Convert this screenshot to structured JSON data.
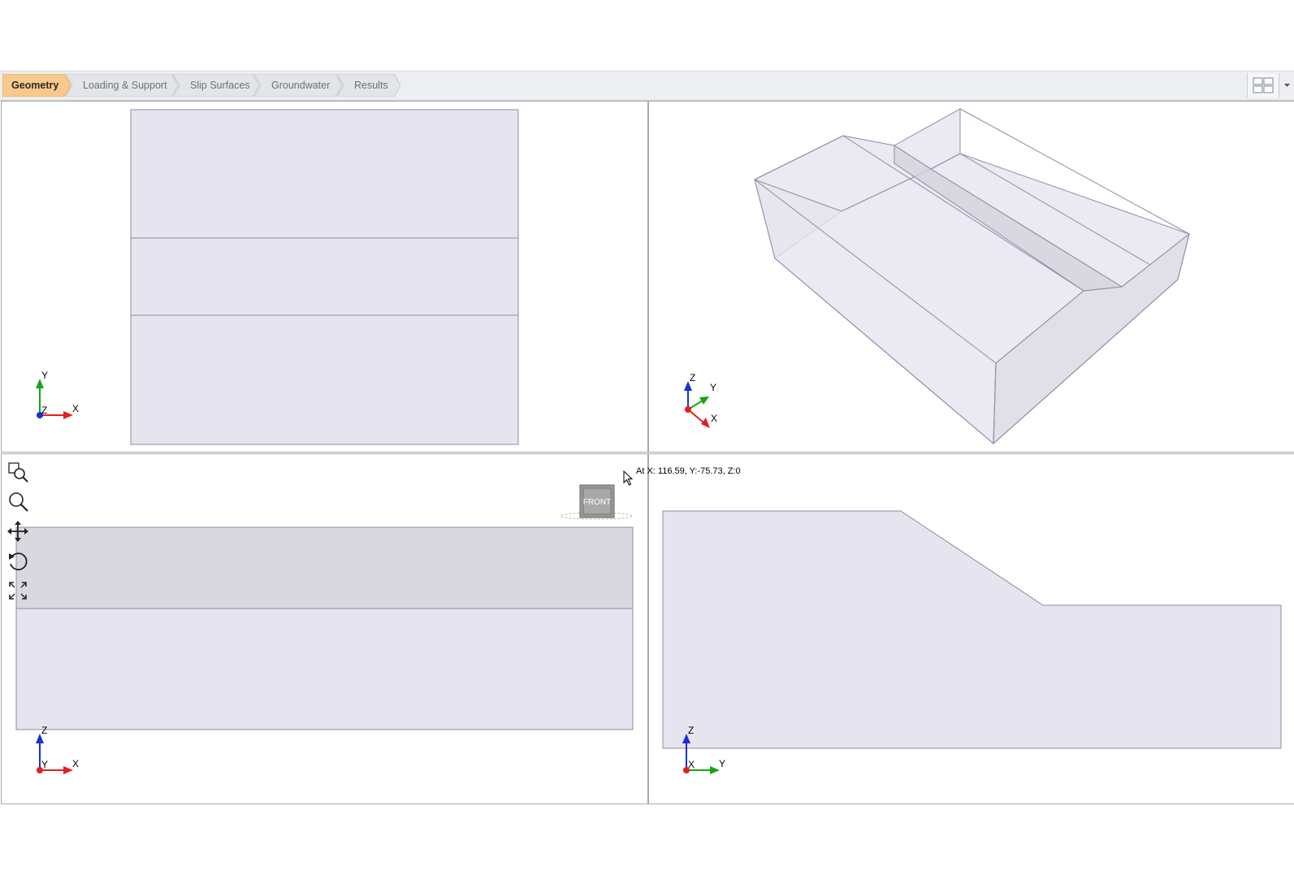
{
  "workflow": {
    "tabs": [
      {
        "label": "Geometry",
        "active": true
      },
      {
        "label": "Loading & Support",
        "active": false
      },
      {
        "label": "Slip Surfaces",
        "active": false
      },
      {
        "label": "Groundwater",
        "active": false
      },
      {
        "label": "Results",
        "active": false
      }
    ],
    "layout_button_icon": "four-pane-layout-icon",
    "layout_dropdown_icon": "caret-down-icon"
  },
  "viewports": {
    "top": {
      "axes": {
        "horizontal": "X",
        "vertical": "Y",
        "normal": "Z"
      }
    },
    "perspective": {
      "axes": {
        "up": "Z",
        "depth": "Y",
        "right": "X"
      }
    },
    "front": {
      "axes": {
        "horizontal": "X",
        "vertical": "Z",
        "normal": "Y"
      },
      "view_cube_label": "FRONT"
    },
    "side": {
      "axes": {
        "horizontal": "Y",
        "vertical": "Z",
        "normal": "X"
      }
    }
  },
  "toolbar": {
    "tools": [
      "zoom-window-icon",
      "zoom-icon",
      "pan-icon",
      "rotate-icon",
      "zoom-extents-icon"
    ]
  },
  "status": {
    "cursor_coordinates": "At X: 116.59, Y:-75.73, Z:0"
  },
  "colors": {
    "active_tab": "#f9c98c",
    "model_fill": "#e6e4ee",
    "model_edge": "#8e8aa8",
    "highlight_fill": "#d9d8de"
  }
}
